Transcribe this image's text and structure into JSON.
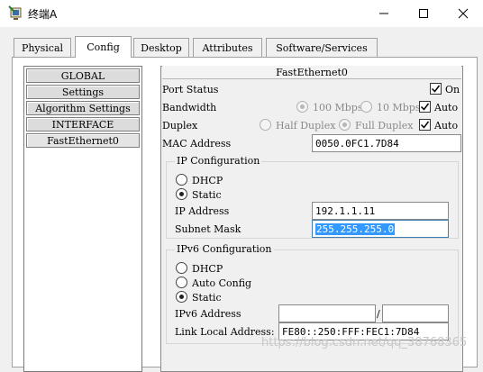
{
  "window": {
    "title": "终端A",
    "controls": {
      "minimize": "minimize-icon",
      "maximize": "maximize-icon",
      "close": "close-icon"
    }
  },
  "tabs": [
    {
      "label": "Physical",
      "active": false
    },
    {
      "label": "Config",
      "active": true
    },
    {
      "label": "Desktop",
      "active": false
    },
    {
      "label": "Attributes",
      "active": false
    },
    {
      "label": "Software/Services",
      "active": false
    }
  ],
  "sidebar": {
    "items": [
      {
        "label": "GLOBAL"
      },
      {
        "label": "Settings"
      },
      {
        "label": "Algorithm Settings"
      },
      {
        "label": "INTERFACE"
      },
      {
        "label": "FastEthernet0",
        "selected": true
      }
    ]
  },
  "interface": {
    "title": "FastEthernet0",
    "port_status": {
      "label": "Port Status",
      "on_label": "On",
      "checked": true
    },
    "bandwidth": {
      "label": "Bandwidth",
      "option_100": "100 Mbps",
      "option_10": "10 Mbps",
      "auto_label": "Auto",
      "auto_checked": true
    },
    "duplex": {
      "label": "Duplex",
      "option_half": "Half Duplex",
      "option_full": "Full Duplex",
      "auto_label": "Auto",
      "auto_checked": true
    },
    "mac": {
      "label": "MAC Address",
      "value": "0050.0FC1.7D84"
    },
    "ipv4": {
      "group_label": "IP Configuration",
      "dhcp_label": "DHCP",
      "static_label": "Static",
      "mode": "Static",
      "ip_label": "IP Address",
      "ip_value": "192.1.1.11",
      "mask_label": "Subnet Mask",
      "mask_value": "255.255.255.0"
    },
    "ipv6": {
      "group_label": "IPv6 Configuration",
      "dhcp_label": "DHCP",
      "auto_label": "Auto Config",
      "static_label": "Static",
      "mode": "Static",
      "addr_label": "IPv6 Address",
      "addr_value": "",
      "prefix_sep": "/",
      "prefix_value": "",
      "link_local_label": "Link Local Address:",
      "link_local_value": "FE80::250:FFF:FEC1:7D84"
    }
  },
  "watermark": "https://blog.csdn.net/qq_38768365",
  "colors": {
    "selection": "#3399ff",
    "accent_icon": "#2e7d32"
  }
}
